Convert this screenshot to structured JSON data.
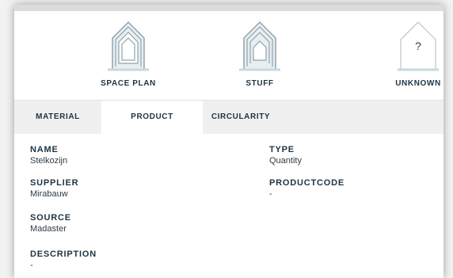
{
  "layers": [
    {
      "label": "SPACE PLAN",
      "icon": "house-space-plan-icon"
    },
    {
      "label": "STUFF",
      "icon": "house-stuff-icon"
    },
    {
      "label": "UNKNOWN",
      "icon": "house-unknown-icon",
      "symbol": "?"
    }
  ],
  "tabs": [
    {
      "label": "MATERIAL"
    },
    {
      "label": "PRODUCT",
      "active": true
    },
    {
      "label": "CIRCULARITY"
    }
  ],
  "fields": {
    "name": {
      "label": "NAME",
      "value": "Stelkozijn"
    },
    "supplier": {
      "label": "SUPPLIER",
      "value": "Mirabauw"
    },
    "source": {
      "label": "SOURCE",
      "value": "Madaster"
    },
    "description": {
      "label": "DESCRIPTION",
      "value": "-"
    },
    "type": {
      "label": "TYPE",
      "value": "Quantity"
    },
    "productcode": {
      "label": "PRODUCTCODE",
      "value": "-"
    }
  },
  "colors": {
    "icon_stroke": "#8fa3ad",
    "icon_fill": "#e9eef1",
    "icon_base": "#c5d9e0",
    "text_dark": "#1d3445"
  }
}
